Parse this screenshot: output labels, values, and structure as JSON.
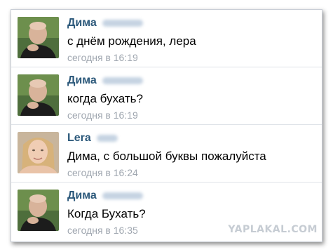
{
  "messages": [
    {
      "author": "Дима",
      "text": "с днём рождения, лера",
      "time": "сегодня в 16:19",
      "avatar": "bald-man-avatar"
    },
    {
      "author": "Дима",
      "text": "когда бухать?",
      "time": "сегодня в 16:19",
      "avatar": "bald-man-avatar"
    },
    {
      "author": "Lera",
      "text": "Дима, с большой буквы пожалуйста",
      "time": "сегодня в 16:24",
      "avatar": "blonde-woman-avatar"
    },
    {
      "author": "Дима",
      "text": "Когда Бухать?",
      "time": "сегодня в 16:35",
      "avatar": "bald-man-avatar"
    }
  ],
  "watermark": "YAPLAKAL.COM",
  "colors": {
    "author": "#2b587a",
    "time": "#a0a7b0",
    "divider": "#dfe3e8"
  }
}
